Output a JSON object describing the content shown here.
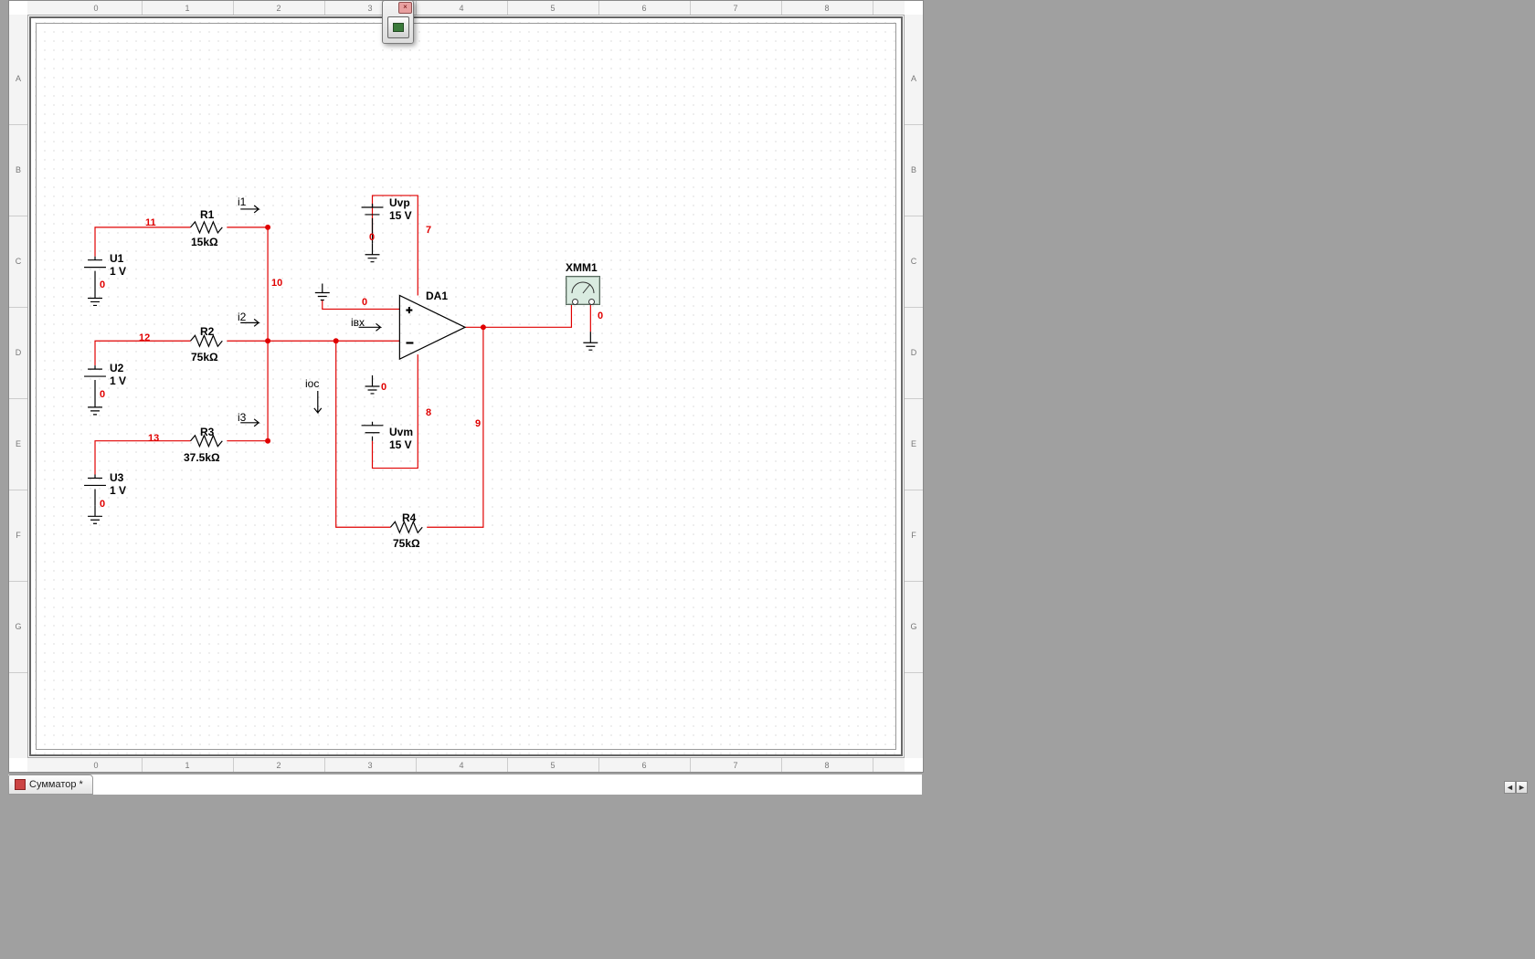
{
  "doc_tab": {
    "label": "Сумматор *"
  },
  "toolbar": {
    "close": "×"
  },
  "ruler_cols": [
    "0",
    "1",
    "2",
    "3",
    "4",
    "5",
    "6",
    "7",
    "8"
  ],
  "ruler_rows": [
    "A",
    "B",
    "C",
    "D",
    "E",
    "F",
    "G"
  ],
  "scroll": {
    "left": "◄",
    "right": "►"
  },
  "schematic": {
    "sources": {
      "U1": {
        "ref": "U1",
        "value": "1 V"
      },
      "U2": {
        "ref": "U2",
        "value": "1 V"
      },
      "U3": {
        "ref": "U3",
        "value": "1 V"
      },
      "Uvp": {
        "ref": "Uvp",
        "value": "15 V"
      },
      "Uvm": {
        "ref": "Uvm",
        "value": "15 V"
      }
    },
    "resistors": {
      "R1": {
        "ref": "R1",
        "value": "15kΩ"
      },
      "R2": {
        "ref": "R2",
        "value": "75kΩ"
      },
      "R3": {
        "ref": "R3",
        "value": "37.5kΩ"
      },
      "R4": {
        "ref": "R4",
        "value": "75kΩ"
      }
    },
    "opamp": {
      "ref": "DA1"
    },
    "instrument": {
      "ref": "XMM1",
      "plus": "+",
      "minus": "−"
    },
    "currents": {
      "i1": "i1",
      "i2": "i2",
      "i3": "i3",
      "ivx": "iвх",
      "ioc": "iос"
    },
    "nets": {
      "n0a": "0",
      "n0b": "0",
      "n0c": "0",
      "n0d": "0",
      "n0e": "0",
      "n0f": "0",
      "n0g": "0",
      "n7": "7",
      "n8": "8",
      "n9": "9",
      "n10": "10",
      "n11": "11",
      "n12": "12",
      "n13": "13"
    }
  }
}
